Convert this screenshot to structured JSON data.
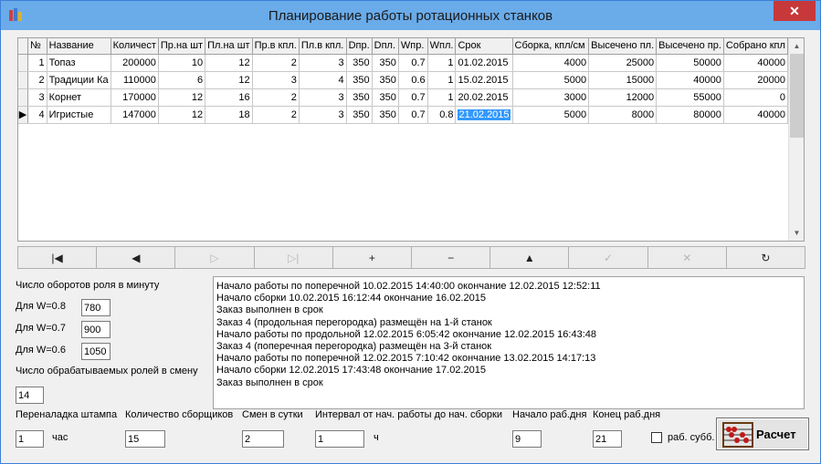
{
  "window": {
    "title": "Планирование работы  ротационных станков",
    "close": "✕"
  },
  "grid": {
    "columns": [
      "№",
      "Название",
      "Количест",
      "Пр.на шт",
      "Пл.на шт",
      "Пр.в кпл.",
      "Пл.в кпл.",
      "Dпр.",
      "Dпл.",
      "Wпр.",
      "Wпл.",
      "Срок",
      "Сборка, кпл/см",
      "Высечено пл.",
      "Высечено пр.",
      "Собрано кпл"
    ],
    "rows": [
      [
        "1",
        "Топаз",
        "200000",
        "10",
        "12",
        "2",
        "3",
        "350",
        "350",
        "0.7",
        "1",
        "01.02.2015",
        "4000",
        "25000",
        "50000",
        "40000"
      ],
      [
        "2",
        "Традиции Ка",
        "110000",
        "6",
        "12",
        "3",
        "4",
        "350",
        "350",
        "0.6",
        "1",
        "15.02.2015",
        "5000",
        "15000",
        "40000",
        "20000"
      ],
      [
        "3",
        "Корнет",
        "170000",
        "12",
        "16",
        "2",
        "3",
        "350",
        "350",
        "0.7",
        "1",
        "20.02.2015",
        "3000",
        "12000",
        "55000",
        "0"
      ],
      [
        "4",
        "Игристые",
        "147000",
        "12",
        "18",
        "2",
        "3",
        "350",
        "350",
        "0.7",
        "0.8",
        "21.02.2015",
        "5000",
        "8000",
        "80000",
        "40000"
      ]
    ],
    "current_row": 3
  },
  "navigator": [
    {
      "icon": "first-icon",
      "glyph": "|◀",
      "enabled": true
    },
    {
      "icon": "prior-icon",
      "glyph": "◀",
      "enabled": true
    },
    {
      "icon": "next-icon",
      "glyph": "▷",
      "enabled": false
    },
    {
      "icon": "last-icon",
      "glyph": "▷|",
      "enabled": false
    },
    {
      "icon": "insert-icon",
      "glyph": "+",
      "enabled": true
    },
    {
      "icon": "delete-icon",
      "glyph": "−",
      "enabled": true
    },
    {
      "icon": "edit-icon",
      "glyph": "▲",
      "enabled": true
    },
    {
      "icon": "post-icon",
      "glyph": "✓",
      "enabled": false
    },
    {
      "icon": "cancel-icon",
      "glyph": "✕",
      "enabled": false
    },
    {
      "icon": "refresh-icon",
      "glyph": "↻",
      "enabled": true
    }
  ],
  "params": {
    "rpm_label": "Число оборотов роля в минуту",
    "w08_label": "Для W=0.8",
    "w08_value": "780",
    "w07_label": "Для W=0.7",
    "w07_value": "900",
    "w06_label": "Для W=0.6",
    "w06_value": "1050",
    "rolls_label": "Число обрабатываемых ролей в смену",
    "rolls_value": "14"
  },
  "log": [
    "Начало работы по поперечной 10.02.2015 14:40:00 окончание 12.02.2015 12:52:11",
    "Начало сборки 10.02.2015 16:12:44 окончание 16.02.2015",
    "Заказ выполнен в срок",
    "Заказ 4 (продольная перегородка) размещён на 1-й станок",
    "Начало работы по продольной 12.02.2015 6:05:42 окончание 12.02.2015 16:43:48",
    "Заказ 4 (поперечная перегородка) размещён на 3-й станок",
    "Начало работы по поперечной 12.02.2015 7:10:42 окончание 13.02.2015 14:17:13",
    "Начало сборки 12.02.2015 17:43:48 окончание 17.02.2015",
    "Заказ выполнен в срок"
  ],
  "bottom": {
    "setup_label": "Переналадка штампа",
    "setup_value": "1",
    "setup_unit": "час",
    "assemblers_label": "Количество сборщиков",
    "assemblers_value": "15",
    "shifts_label": "Смен в сутки",
    "shifts_value": "2",
    "interval_label": "Интервал  от нач. работы до нач. сборки",
    "interval_value": "1",
    "interval_unit": "ч",
    "day_start_label": "Начало раб.дня",
    "day_start_value": "9",
    "day_end_label": "Конец раб.дня",
    "day_end_value": "21",
    "saturday_label": "раб. субб.",
    "calc_label": "Расчет"
  }
}
